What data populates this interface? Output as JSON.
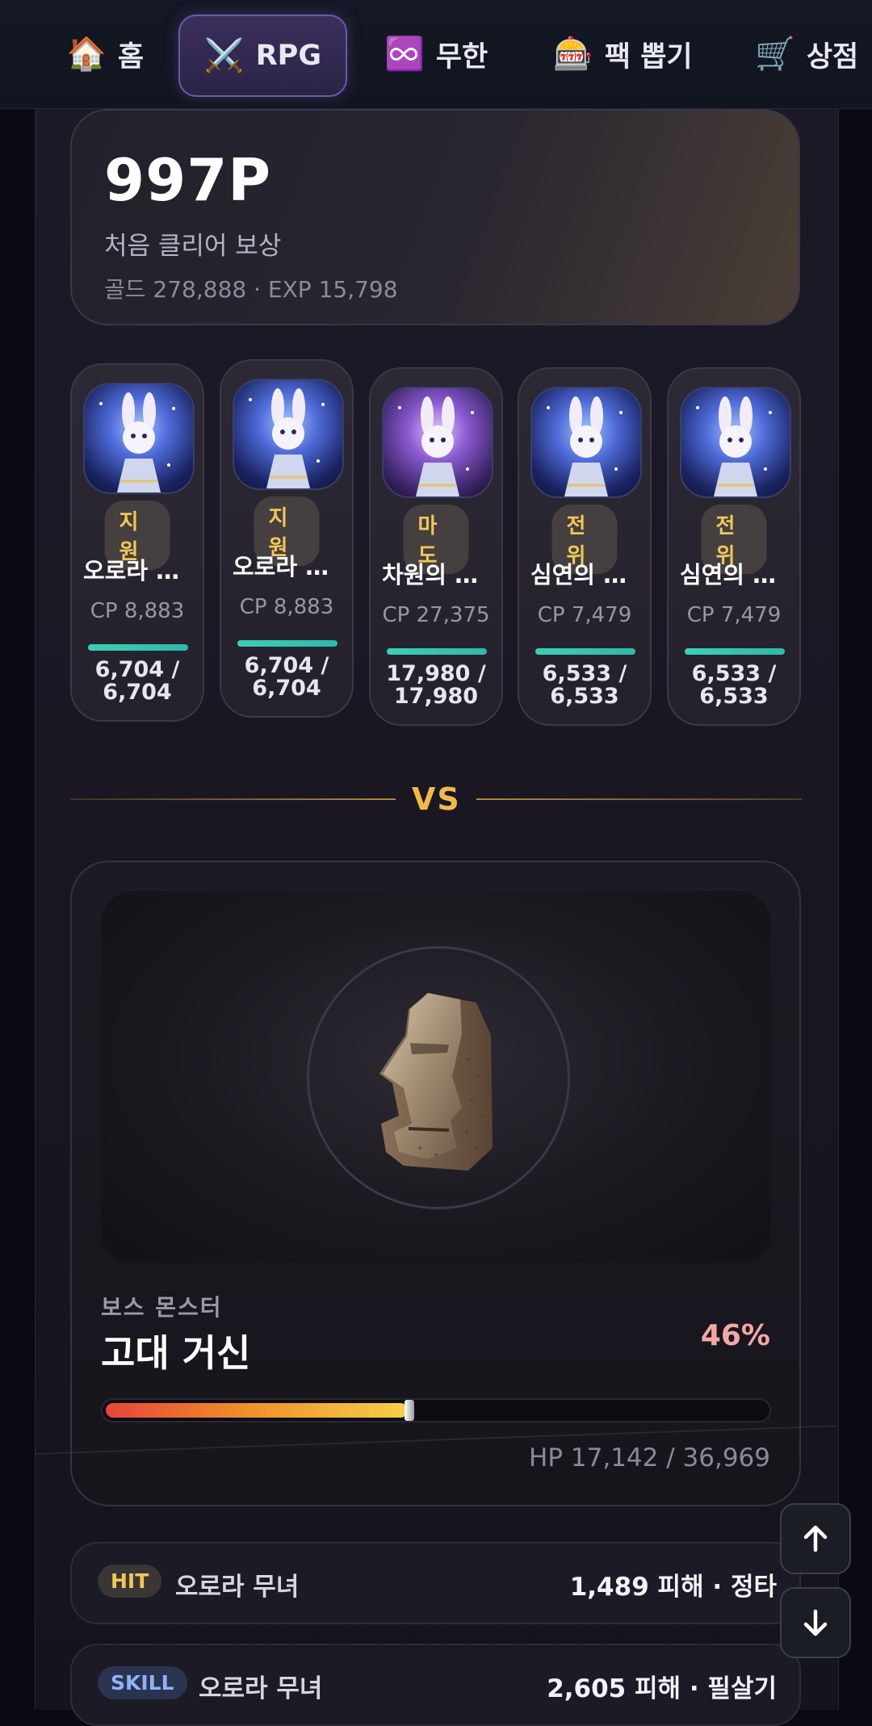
{
  "nav": {
    "tabs": [
      {
        "icon": "house-icon",
        "glyph": "🏠",
        "label": "홈"
      },
      {
        "icon": "crossed-swords-icon",
        "glyph": "⚔️",
        "label": "RPG",
        "active": true
      },
      {
        "icon": "infinity-icon",
        "glyph": "♾️",
        "label": "무한"
      },
      {
        "icon": "slot-machine-icon",
        "glyph": "🎰",
        "label": "팩 뽑기"
      },
      {
        "icon": "shopping-cart-icon",
        "glyph": "🛒",
        "label": "상점"
      }
    ]
  },
  "reward": {
    "points": "997P",
    "label": "처음 클리어 보상",
    "detail": "골드 278,888 · EXP 15,798"
  },
  "heroes": [
    {
      "role": "지원",
      "name": "오로라 …",
      "cp": "CP 8,883",
      "hp_line1": "6,704 /",
      "hp_line2": "6,704",
      "hp_fraction": 1.0,
      "portrait": "blue"
    },
    {
      "role": "지원",
      "name": "오로라 …",
      "cp": "CP 8,883",
      "hp_line1": "6,704 /",
      "hp_line2": "6,704",
      "hp_fraction": 1.0,
      "portrait": "blue"
    },
    {
      "role": "마도",
      "name": "차원의 …",
      "cp": "CP 27,375",
      "hp_line1": "17,980 /",
      "hp_line2": "17,980",
      "hp_fraction": 1.0,
      "portrait": "purple"
    },
    {
      "role": "전위",
      "name": "심연의 …",
      "cp": "CP 7,479",
      "hp_line1": "6,533 /",
      "hp_line2": "6,533",
      "hp_fraction": 1.0,
      "portrait": "blue"
    },
    {
      "role": "전위",
      "name": "심연의 …",
      "cp": "CP 7,479",
      "hp_line1": "6,533 /",
      "hp_line2": "6,533",
      "hp_fraction": 1.0,
      "portrait": "blue"
    }
  ],
  "versus": "VS",
  "boss": {
    "kind": "보스 몬스터",
    "name": "고대 거신",
    "percent": "46%",
    "hp_fraction": 0.46,
    "hp_text": "HP 17,142 / 36,969",
    "icon": "moai-icon"
  },
  "log": [
    {
      "badge": "HIT",
      "type": "hit",
      "actor": "오로라 무녀",
      "result": "1,489 피해 · 정타"
    },
    {
      "badge": "SKILL",
      "type": "skill",
      "actor": "오로라 무녀",
      "result": "2,605 피해 · 필살기"
    }
  ],
  "scroll": {
    "up": "arrow-up-icon",
    "down": "arrow-down-icon"
  }
}
